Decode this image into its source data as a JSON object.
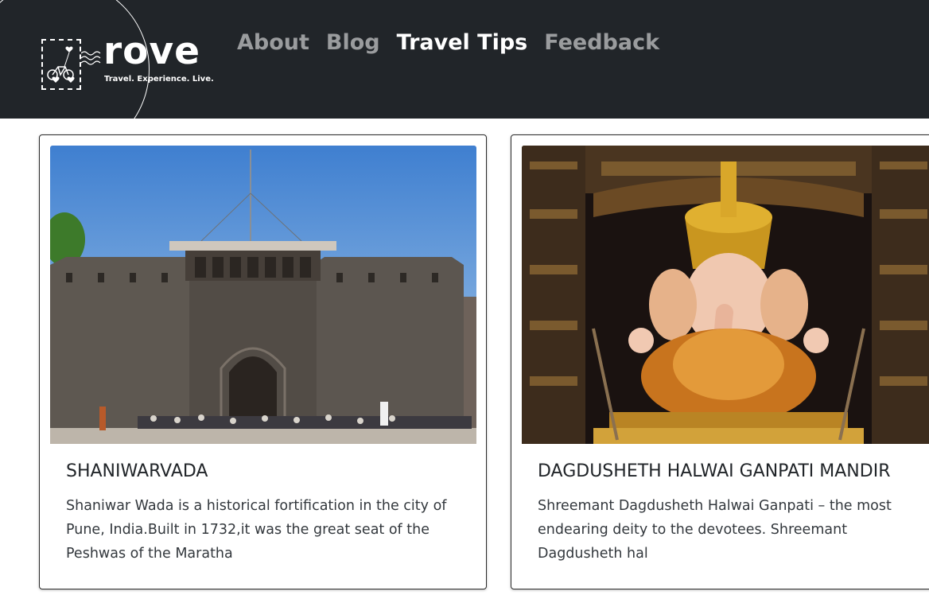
{
  "brand": {
    "name": "rove",
    "tagline": "Travel. Experience. Live."
  },
  "nav": {
    "items": [
      {
        "label": "About",
        "active": false
      },
      {
        "label": "Blog",
        "active": false
      },
      {
        "label": "Travel Tips",
        "active": true
      },
      {
        "label": "Feedback",
        "active": false
      }
    ]
  },
  "cards": [
    {
      "image": "shaniwarwada-fort-photo",
      "title": "SHANIWARVADA",
      "text": "Shaniwar Wada is a historical fortification in the city of Pune, India.Built in 1732,it was the great seat of the Peshwas of the Maratha"
    },
    {
      "image": "ganpati-idol-photo",
      "title": "DAGDUSHETH HALWAI GANPATI MANDIR",
      "text": "Shreemant Dagdusheth Halwai Ganpati – the most endearing deity to the devotees. Shreemant Dagdusheth hal"
    }
  ],
  "colors": {
    "navbar_bg": "#212529",
    "nav_active": "#ffffff",
    "nav_inactive": "#a6a8aa"
  }
}
